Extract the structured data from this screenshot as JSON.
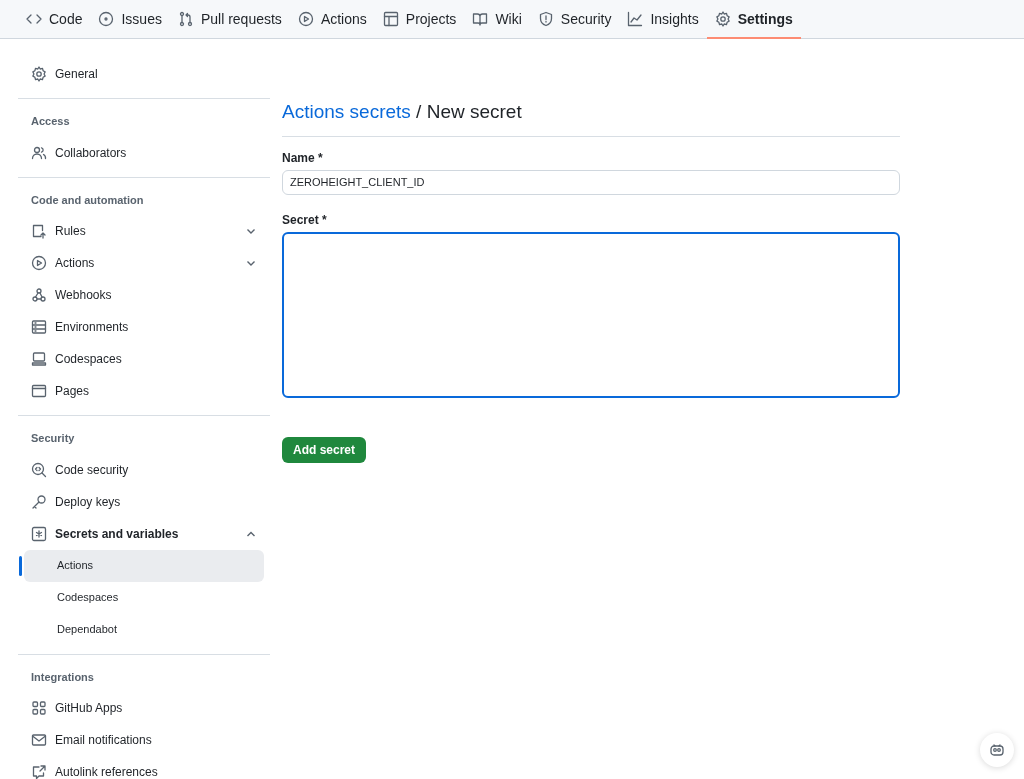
{
  "repo_nav": [
    {
      "label": "Code",
      "selected": false
    },
    {
      "label": "Issues",
      "selected": false
    },
    {
      "label": "Pull requests",
      "selected": false
    },
    {
      "label": "Actions",
      "selected": false
    },
    {
      "label": "Projects",
      "selected": false
    },
    {
      "label": "Wiki",
      "selected": false
    },
    {
      "label": "Security",
      "selected": false
    },
    {
      "label": "Insights",
      "selected": false
    },
    {
      "label": "Settings",
      "selected": true
    }
  ],
  "sidebar": {
    "sections": [
      {
        "items": [
          {
            "label": "General"
          }
        ]
      },
      {
        "heading": "Access",
        "items": [
          {
            "label": "Collaborators"
          }
        ]
      },
      {
        "heading": "Code and automation",
        "items": [
          {
            "label": "Rules",
            "expanded": false
          },
          {
            "label": "Actions",
            "expanded": false
          },
          {
            "label": "Webhooks"
          },
          {
            "label": "Environments"
          },
          {
            "label": "Codespaces"
          },
          {
            "label": "Pages"
          }
        ]
      },
      {
        "heading": "Security",
        "items": [
          {
            "label": "Code security"
          },
          {
            "label": "Deploy keys"
          },
          {
            "label": "Secrets and variables",
            "expanded": true,
            "children": [
              {
                "label": "Actions",
                "selected": true
              },
              {
                "label": "Codespaces",
                "selected": false
              },
              {
                "label": "Dependabot",
                "selected": false
              }
            ]
          }
        ]
      },
      {
        "heading": "Integrations",
        "items": [
          {
            "label": "GitHub Apps"
          },
          {
            "label": "Email notifications"
          },
          {
            "label": "Autolink references"
          }
        ]
      }
    ]
  },
  "main": {
    "breadcrumb_link": "Actions secrets",
    "title": "/ New secret",
    "name_field": {
      "label": "Name *",
      "value": "ZEROHEIGHT_CLIENT_ID"
    },
    "secret_field": {
      "label": "Secret *",
      "focused": true
    },
    "submit": "Add secret"
  }
}
